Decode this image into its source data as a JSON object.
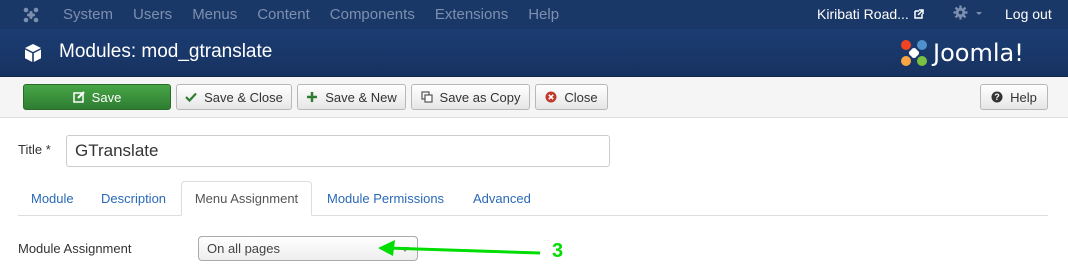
{
  "navbar": {
    "menu": [
      "System",
      "Users",
      "Menus",
      "Content",
      "Components",
      "Extensions",
      "Help"
    ],
    "site_name": "Kiribati Road...",
    "logout": "Log out"
  },
  "header": {
    "title": "Modules: mod_gtranslate",
    "brand": "Joomla!"
  },
  "toolbar": {
    "save": "Save",
    "save_close": "Save & Close",
    "save_new": "Save & New",
    "save_copy": "Save as Copy",
    "close": "Close",
    "help": "Help"
  },
  "form": {
    "title_label": "Title *",
    "title_value": "GTranslate"
  },
  "tabs": [
    "Module",
    "Description",
    "Menu Assignment",
    "Module Permissions",
    "Advanced"
  ],
  "active_tab": "Menu Assignment",
  "assignment": {
    "label": "Module Assignment",
    "selected": "On all pages"
  },
  "annotation": {
    "number": "3",
    "color": "#00dd00"
  },
  "colors": {
    "navbar": "#1a3867",
    "header": "#1c3d73",
    "save_green": "#46a546",
    "link_blue": "#2a69b8"
  }
}
